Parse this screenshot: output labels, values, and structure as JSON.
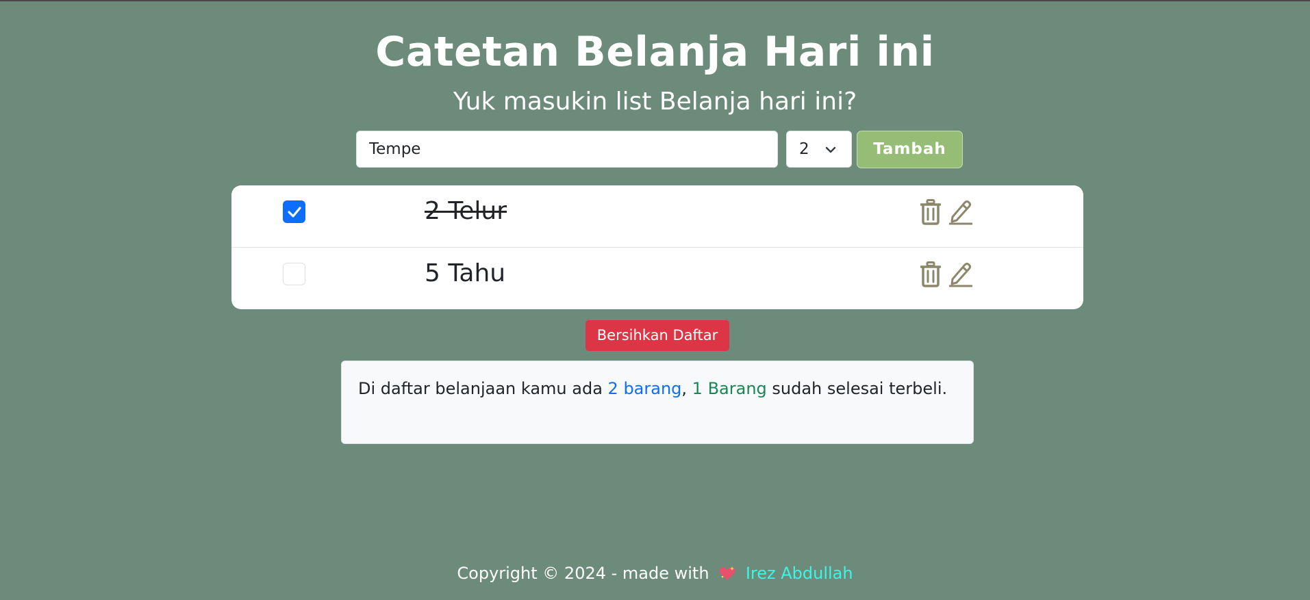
{
  "header": {
    "title": "Catetan Belanja Hari ini",
    "subtitle": "Yuk masukin list Belanja hari ini?"
  },
  "form": {
    "item_value": "Tempe",
    "quantity_selected": "2",
    "add_label": "Tambah"
  },
  "list": {
    "items": [
      {
        "text": "2 Telur",
        "checked": true
      },
      {
        "text": "5 Tahu",
        "checked": false
      }
    ]
  },
  "actions": {
    "clear_label": "Bersihkan Daftar"
  },
  "summary": {
    "prefix": "Di daftar belanjaan kamu ada ",
    "total": "2 barang",
    "separator": ", ",
    "done": "1 Barang",
    "suffix": " sudah selesai terbeli."
  },
  "footer": {
    "copyright": "Copyright © 2024 - made with",
    "author": "Irez Abdullah"
  },
  "colors": {
    "background": "#6d8b7a",
    "add_button": "#96bd75",
    "clear_button": "#dc3545",
    "checkbox_checked": "#0d6efd",
    "icons": "#8c876a",
    "author_link": "#3df5e5",
    "total_highlight": "#0d6efd",
    "done_highlight": "#198754"
  },
  "icons": {
    "delete": "trash-icon",
    "edit": "pencil-icon",
    "select": "chevron-down-icon",
    "heart": "sparkling-heart-icon"
  }
}
